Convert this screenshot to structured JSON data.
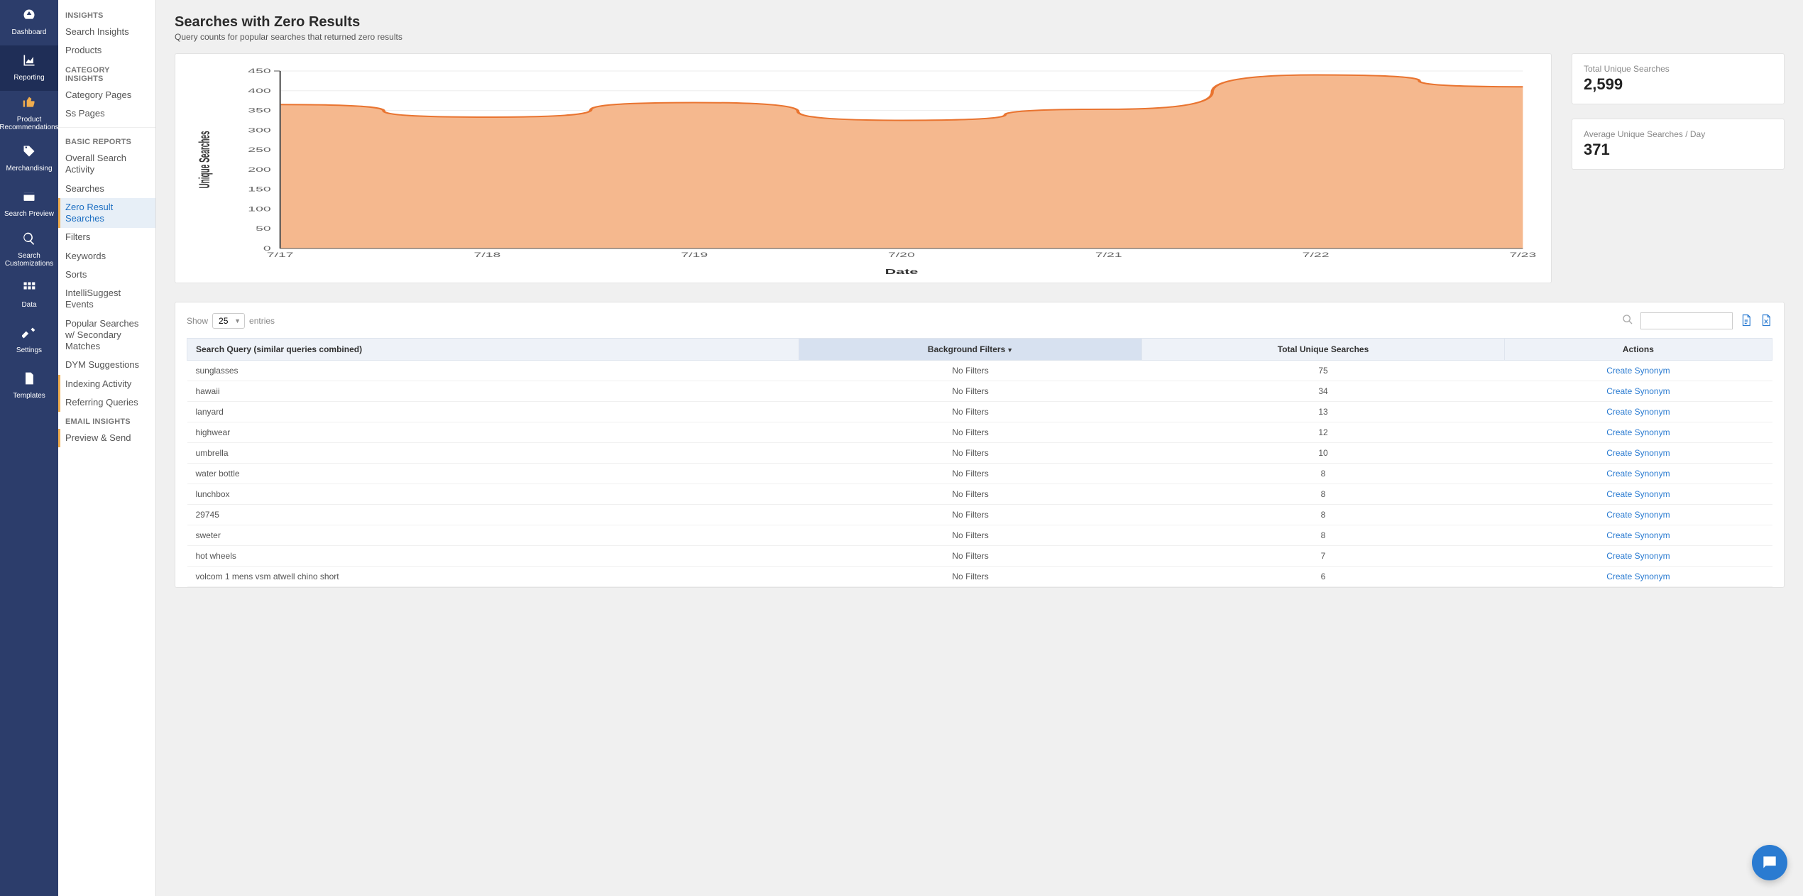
{
  "nav": {
    "items": [
      {
        "key": "dashboard",
        "label": "Dashboard",
        "icon": "gauge"
      },
      {
        "key": "reporting",
        "label": "Reporting",
        "icon": "chart-area",
        "active": true
      },
      {
        "key": "product-recs",
        "label": "Product Recommendations",
        "icon": "thumbs-up",
        "highlight": true
      },
      {
        "key": "merchandising",
        "label": "Merchandising",
        "icon": "tag"
      },
      {
        "key": "search-preview",
        "label": "Search Preview",
        "icon": "window"
      },
      {
        "key": "search-custom",
        "label": "Search Customizations",
        "icon": "magnify"
      },
      {
        "key": "data",
        "label": "Data",
        "icon": "grid"
      },
      {
        "key": "settings",
        "label": "Settings",
        "icon": "wrench"
      },
      {
        "key": "templates",
        "label": "Templates",
        "icon": "file"
      }
    ]
  },
  "sidebar": {
    "sections": [
      {
        "heading": "INSIGHTS",
        "items": [
          {
            "label": "Search Insights"
          },
          {
            "label": "Products"
          }
        ]
      },
      {
        "heading": "CATEGORY INSIGHTS",
        "items": [
          {
            "label": "Category Pages"
          },
          {
            "label": "Ss Pages"
          }
        ],
        "dividerAfter": true
      },
      {
        "heading": "BASIC REPORTS",
        "items": [
          {
            "label": "Overall Search Activity"
          },
          {
            "label": "Searches"
          },
          {
            "label": "Zero Result Searches",
            "selected": true
          },
          {
            "label": "Filters"
          },
          {
            "label": "Keywords"
          },
          {
            "label": "Sorts"
          },
          {
            "label": "IntelliSuggest Events"
          },
          {
            "label": "Popular Searches w/ Secondary Matches"
          },
          {
            "label": "DYM Suggestions"
          },
          {
            "label": "Indexing Activity",
            "marked": true
          },
          {
            "label": "Referring Queries",
            "marked": true
          }
        ]
      },
      {
        "heading": "EMAIL INSIGHTS",
        "items": [
          {
            "label": "Preview & Send",
            "marked": true
          }
        ]
      }
    ]
  },
  "header": {
    "title": "Searches with Zero Results",
    "subtitle": "Query counts for popular searches that returned zero results"
  },
  "stats": [
    {
      "label": "Total Unique Searches",
      "value": "2,599"
    },
    {
      "label": "Average Unique Searches / Day",
      "value": "371"
    }
  ],
  "show": {
    "prefix": "Show",
    "value": "25",
    "suffix": "entries"
  },
  "table": {
    "columns": [
      {
        "label": "Search Query (similar queries combined)",
        "align": "left"
      },
      {
        "label": "Background Filters",
        "align": "center",
        "sorted": true,
        "dir": "desc"
      },
      {
        "label": "Total Unique Searches",
        "align": "center"
      },
      {
        "label": "Actions",
        "align": "center"
      }
    ],
    "action_label": "Create Synonym",
    "rows": [
      {
        "q": "sunglasses",
        "f": "No Filters",
        "c": "75"
      },
      {
        "q": "hawaii",
        "f": "No Filters",
        "c": "34"
      },
      {
        "q": "lanyard",
        "f": "No Filters",
        "c": "13"
      },
      {
        "q": "highwear",
        "f": "No Filters",
        "c": "12"
      },
      {
        "q": "umbrella",
        "f": "No Filters",
        "c": "10"
      },
      {
        "q": "water bottle",
        "f": "No Filters",
        "c": "8"
      },
      {
        "q": "lunchbox",
        "f": "No Filters",
        "c": "8"
      },
      {
        "q": "29745",
        "f": "No Filters",
        "c": "8"
      },
      {
        "q": "sweter",
        "f": "No Filters",
        "c": "8"
      },
      {
        "q": "hot wheels",
        "f": "No Filters",
        "c": "7"
      },
      {
        "q": "volcom 1 mens vsm atwell chino short",
        "f": "No Filters",
        "c": "6"
      }
    ]
  },
  "chart_data": {
    "type": "area",
    "x": [
      "7/17",
      "7/18",
      "7/19",
      "7/20",
      "7/21",
      "7/22",
      "7/23"
    ],
    "series": [
      {
        "name": "Unique Searches",
        "values": [
          365,
          333,
          370,
          325,
          353,
          440,
          410
        ]
      }
    ],
    "title": "",
    "xlabel": "Date",
    "ylabel": "Unique Searches",
    "ylim": [
      0,
      450
    ],
    "yticks": [
      0,
      50,
      100,
      150,
      200,
      250,
      300,
      350,
      400,
      450
    ],
    "colors": {
      "line": "#e97430",
      "fill": "#f5b88e"
    }
  }
}
